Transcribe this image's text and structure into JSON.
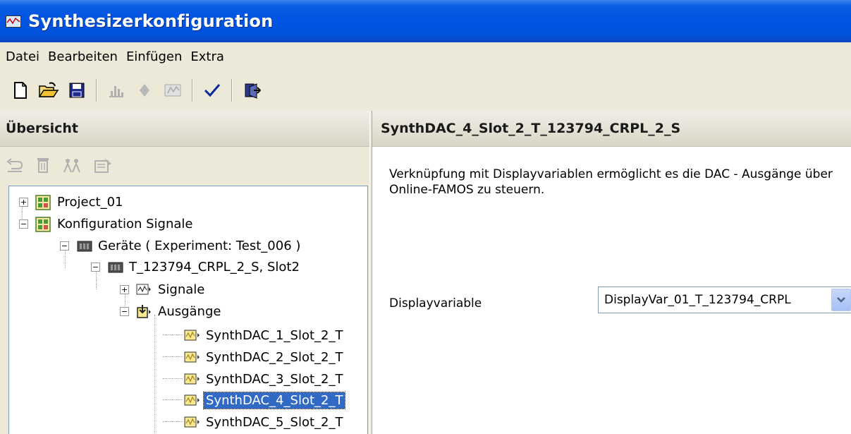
{
  "window": {
    "title": "Synthesizerkonfiguration"
  },
  "menu": [
    "Datei",
    "Bearbeiten",
    "Einfügen",
    "Extra"
  ],
  "toolbar": {
    "icons": [
      "new-document-icon",
      "open-folder-icon",
      "save-icon",
      "chart-icon",
      "diamond-icon",
      "grid-icon",
      "check-icon",
      "exit-icon"
    ]
  },
  "left_panel": {
    "title": "Übersicht",
    "tools": [
      "undo-icon",
      "delete-icon",
      "people-icon",
      "properties-icon"
    ],
    "tree": [
      {
        "label": "Project_01",
        "expander": "+",
        "icon": "project-icon"
      },
      {
        "label": "Konfiguration Signale",
        "expander": "−",
        "icon": "project-icon"
      },
      {
        "label": "Geräte ( Experiment: Test_006 )",
        "expander": "−",
        "icon": "device-icon"
      },
      {
        "label": "T_123794_CRPL_2_S, Slot2",
        "expander": "−",
        "icon": "device-icon"
      },
      {
        "label": "Signale",
        "expander": "+",
        "icon": "signal-icon"
      },
      {
        "label": "Ausgänge",
        "expander": "−",
        "icon": "output-icon"
      },
      {
        "label": "SynthDAC_1_Slot_2_T",
        "expander": "",
        "icon": "dac-icon"
      },
      {
        "label": "SynthDAC_2_Slot_2_T",
        "expander": "",
        "icon": "dac-icon"
      },
      {
        "label": "SynthDAC_3_Slot_2_T",
        "expander": "",
        "icon": "dac-icon"
      },
      {
        "label": "SynthDAC_4_Slot_2_T",
        "expander": "",
        "icon": "dac-icon",
        "selected": true
      },
      {
        "label": "SynthDAC_5_Slot_2_T",
        "expander": "",
        "icon": "dac-icon"
      }
    ]
  },
  "right_panel": {
    "title": "SynthDAC_4_Slot_2_T_123794_CRPL_2_S",
    "description": "Verknüpfung mit Displayvariablen ermöglicht es die DAC - Ausgänge über Online-FAMOS zu steuern.",
    "displayvariable_label": "Displayvariable",
    "displayvariable_value": "DisplayVar_01_T_123794_CRPL"
  }
}
